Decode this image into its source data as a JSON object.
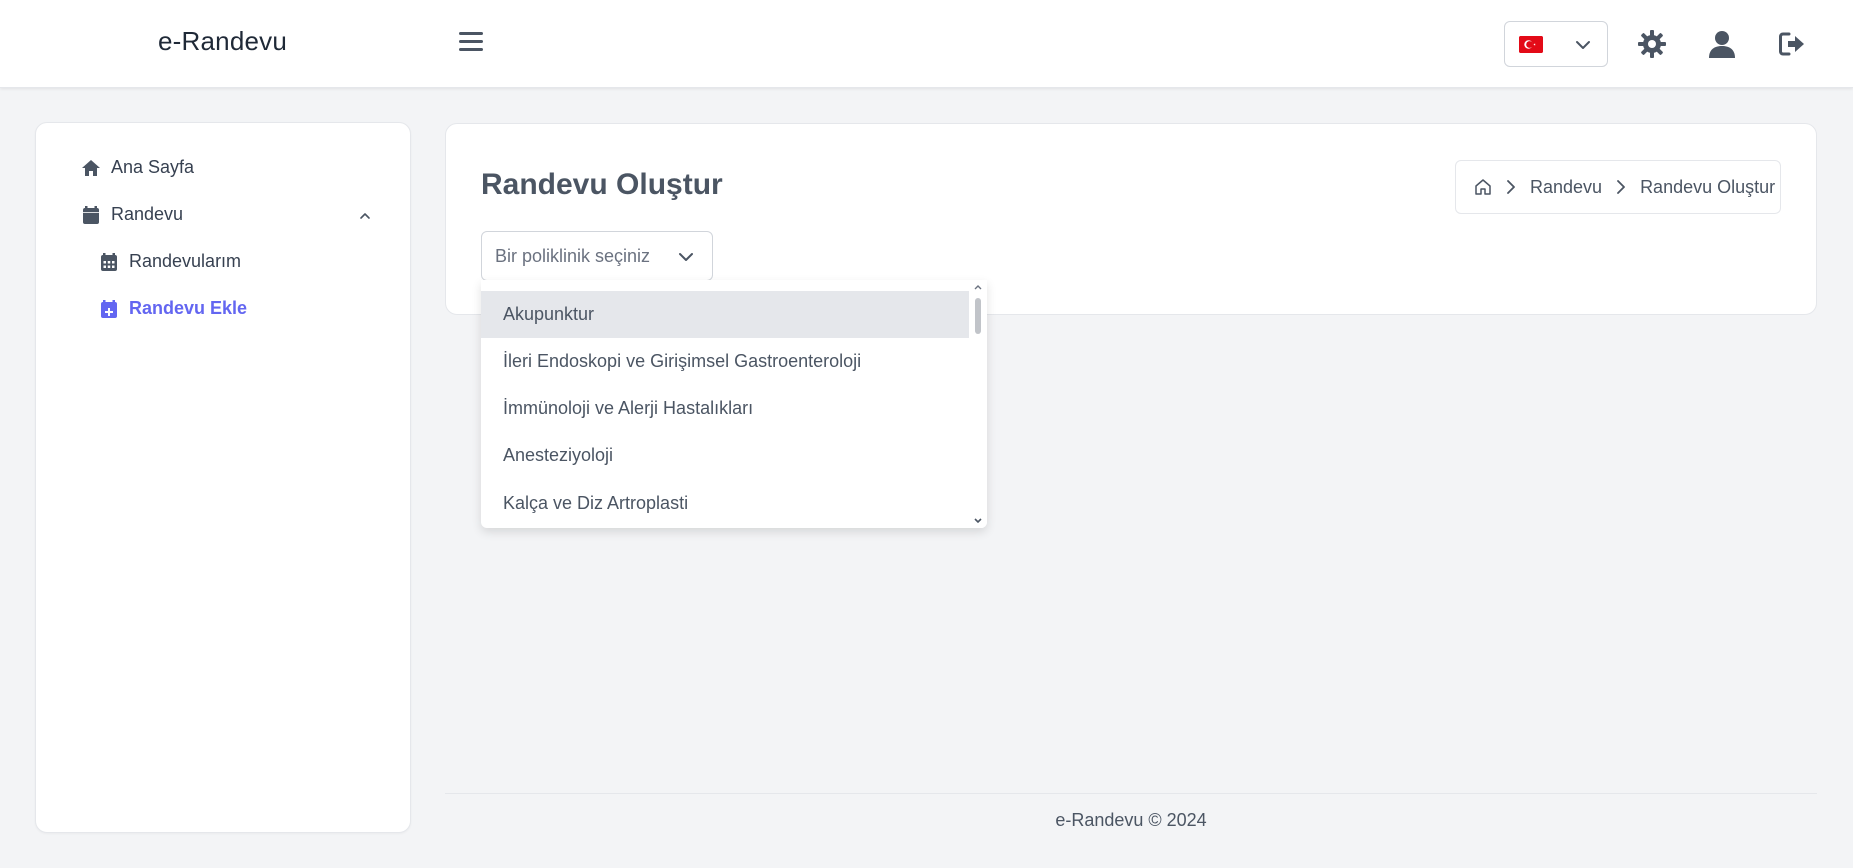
{
  "header": {
    "brand": "e-Randevu",
    "icons": [
      "menu-icon",
      "turkey-flag-icon",
      "chevron-down-icon",
      "settings-icon",
      "user-icon",
      "logout-icon"
    ]
  },
  "sidebar": {
    "items": [
      {
        "label": "Ana Sayfa",
        "icon": "home-icon"
      },
      {
        "label": "Randevu",
        "icon": "calendar-icon"
      },
      {
        "label": "Randevularım",
        "icon": "calendar-days-icon"
      },
      {
        "label": "Randevu Ekle",
        "icon": "calendar-plus-icon"
      }
    ]
  },
  "main": {
    "title": "Randevu Oluştur",
    "breadcrumb": [
      "Randevu",
      "Randevu Oluştur"
    ],
    "select_placeholder": "Bir poliklinik seçiniz",
    "options": [
      "Akupunktur",
      "İleri Endoskopi ve Girişimsel Gastroenteroloji",
      "İmmünoloji ve Alerji Hastalıkları",
      "Anesteziyoloji",
      "Kalça ve Diz Artroplasti"
    ]
  },
  "footer": {
    "text": "e-Randevu © 2024"
  },
  "colors": {
    "accent": "#6366f1",
    "text": "#4b5563",
    "background": "#f3f4f6",
    "highlight": "#e5e7eb"
  }
}
